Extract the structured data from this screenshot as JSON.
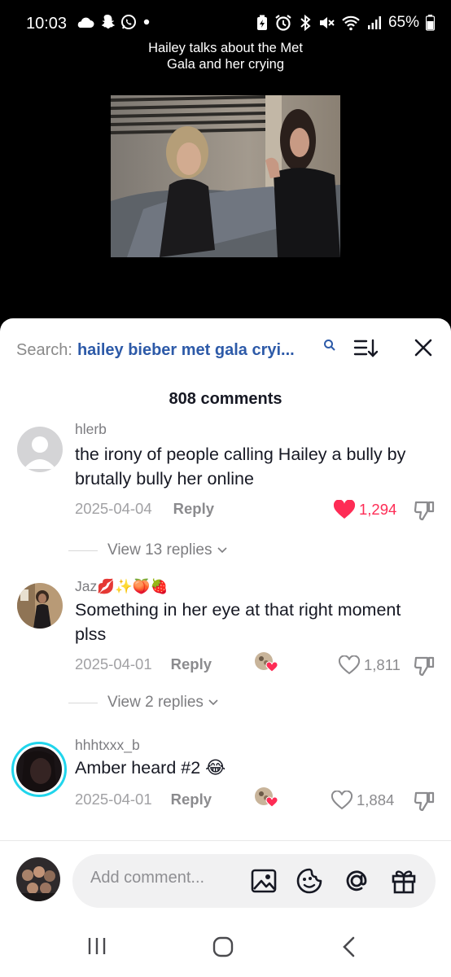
{
  "status": {
    "time": "10:03",
    "battery": "65%",
    "left_icons": [
      "cloud-icon",
      "snapchat-icon",
      "whatsapp-icon",
      "dot-icon"
    ],
    "right_icons": [
      "battery-saver-icon",
      "alarm-icon",
      "bluetooth-icon",
      "mute-icon",
      "wifi-icon",
      "signal-icon",
      "battery-icon"
    ]
  },
  "video": {
    "title_line1": "Hailey talks about the Met",
    "title_line2": "Gala and her crying"
  },
  "sheet": {
    "search_prefix": "Search:",
    "search_query": "hailey bieber met gala cryi...",
    "comment_count": "808 comments"
  },
  "comments": [
    {
      "username": "hlerb",
      "text": "the irony of people calling Hailey a bully by brutally bully her online",
      "date": "2025-04-04",
      "reply_label": "Reply",
      "likes": "1,294",
      "liked": true,
      "replies_label": "View 13 replies"
    },
    {
      "username": "Jaz💋✨🍑🍓",
      "text": "Something in her eye at that right moment plss",
      "date": "2025-04-01",
      "reply_label": "Reply",
      "likes": "1,811",
      "liked": false,
      "replies_label": "View 2 replies"
    },
    {
      "username": "hhhtxxx_b",
      "text": "Amber heard #2 😂",
      "date": "2025-04-01",
      "reply_label": "Reply",
      "likes": "1,884",
      "liked": false
    }
  ],
  "composer": {
    "placeholder": "Add comment..."
  },
  "colors": {
    "accent_red": "#fe2c55",
    "search_blue": "#2d5aa8",
    "story_ring": "#20d5ec"
  }
}
